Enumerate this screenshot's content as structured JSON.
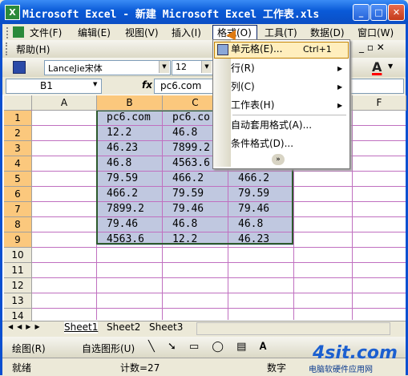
{
  "window": {
    "title": "Microsoft Excel - 新建 Microsoft Excel 工作表.xls",
    "app_icon": "X"
  },
  "menu": [
    "文件(F)",
    "编辑(E)",
    "视图(V)",
    "插入(I)",
    "格式(O)",
    "工具(T)",
    "数据(D)",
    "窗口(W)"
  ],
  "toolbar": {
    "help": "帮助(H)",
    "font_name": "LanceJie宋体",
    "font_size": "12"
  },
  "formula_bar": {
    "cell_ref": "B1",
    "fx": "fx",
    "content": "pc6.com"
  },
  "columns": [
    "A",
    "B",
    "C",
    "D",
    "E",
    "F"
  ],
  "rows": [
    "1",
    "2",
    "3",
    "4",
    "5",
    "6",
    "7",
    "8",
    "9",
    "10",
    "11",
    "12",
    "13",
    "14"
  ],
  "cells": [
    [
      "pc6.com",
      "pc6.co",
      ""
    ],
    [
      "12.2",
      "46.8",
      ""
    ],
    [
      "46.23",
      "7899.2",
      ""
    ],
    [
      "46.8",
      "4563.6",
      ""
    ],
    [
      "79.59",
      "466.2",
      "466.2"
    ],
    [
      "466.2",
      "79.59",
      "79.59"
    ],
    [
      "7899.2",
      "79.46",
      "79.46"
    ],
    [
      "79.46",
      "46.8",
      "46.8"
    ],
    [
      "4563.6",
      "12.2",
      "46.23"
    ]
  ],
  "sheets": [
    "Sheet1",
    "Sheet2",
    "Sheet3"
  ],
  "drawing": {
    "draw": "绘图(R)",
    "autoshape": "自选图形(U)"
  },
  "status": {
    "ready": "就绪",
    "count": "计数=27",
    "num": "数字"
  },
  "format_menu": {
    "cells": "单元格(E)...",
    "cells_shortcut": "Ctrl+1",
    "row": "行(R)",
    "column": "列(C)",
    "sheet": "工作表(H)",
    "autoformat": "自动套用格式(A)...",
    "conditional": "条件格式(D)...",
    "more": "»"
  },
  "watermark": {
    "logo": "4sit.com",
    "sub": "电脑软硬件应用网"
  },
  "colors": {
    "title_bar": "#0a5ad8",
    "selection": "#c0c8e0",
    "header_selected": "#fbc87d",
    "menu_highlight": "#ffeebd"
  }
}
